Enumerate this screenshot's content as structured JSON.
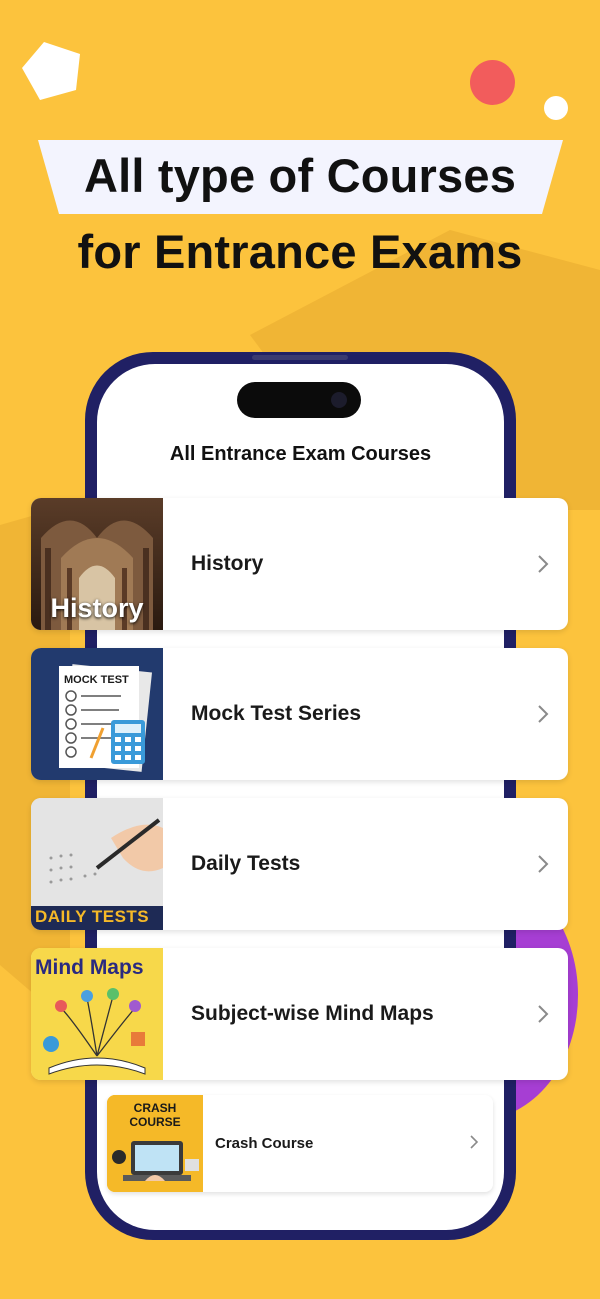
{
  "headline": {
    "line1": "All type of Courses",
    "line2": "for Entrance Exams"
  },
  "screen": {
    "title": "All Entrance Exam Courses"
  },
  "courses": [
    {
      "label": "History",
      "thumb_text": "History"
    },
    {
      "label": "Mock Test Series",
      "thumb_text": "MOCK TEST"
    },
    {
      "label": "Daily Tests",
      "thumb_text": "DAILY TESTS"
    },
    {
      "label": "Subject-wise Mind Maps",
      "thumb_text": "Mind Maps"
    },
    {
      "label": "Crash Course",
      "thumb_text_1": "CRASH",
      "thumb_text_2": "COURSE"
    }
  ],
  "colors": {
    "background": "#FCC33D",
    "phone_frame": "#202064",
    "accent_red": "#F25C5C",
    "accent_purple": "#A63ED3"
  },
  "icons": {
    "chevron": "chevron-right-icon"
  }
}
